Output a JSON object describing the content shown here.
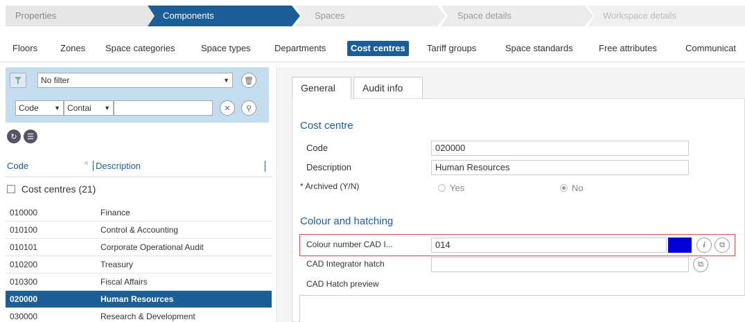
{
  "wizard": {
    "steps": [
      "Properties",
      "Components",
      "Spaces",
      "Space details",
      "Workspace details"
    ]
  },
  "subnav": {
    "items": [
      "Floors",
      "Zones",
      "Space categories",
      "Space types",
      "Departments",
      "Cost centres",
      "Tariff groups",
      "Space standards",
      "Free attributes",
      "Communicat"
    ],
    "active": "Cost centres"
  },
  "filter": {
    "preset_value": "No filter",
    "field_value": "Code",
    "operator_value": "Contai",
    "search_value": ""
  },
  "list": {
    "header_code": "Code",
    "header_sort": "^",
    "header_description": "Description",
    "group_label": "Cost centres (21)",
    "rows": [
      {
        "code": "010000",
        "description": "Finance"
      },
      {
        "code": "010100",
        "description": "Control & Accounting"
      },
      {
        "code": "010101",
        "description": "Corporate Operational Audit"
      },
      {
        "code": "010200",
        "description": "Treasury"
      },
      {
        "code": "010300",
        "description": "Fiscal Affairs"
      },
      {
        "code": "020000",
        "description": "Human Resources"
      },
      {
        "code": "030000",
        "description": "Research & Development"
      }
    ],
    "selected_code": "020000"
  },
  "detail": {
    "tabs": [
      "General",
      "Audit info"
    ],
    "section_cost_centre": "Cost centre",
    "code_label": "Code",
    "code_value": "020000",
    "description_label": "Description",
    "description_value": "Human Resources",
    "archived_label": "* Archived (Y/N)",
    "archived_yes": "Yes",
    "archived_no": "No",
    "section_colour": "Colour and hatching",
    "colour_label": "Colour number CAD I...",
    "colour_value": "014",
    "colour_swatch": "#0000d8",
    "hatch_label": "CAD Integrator hatch",
    "hatch_value": "",
    "hatch_preview_label": "CAD Hatch preview"
  },
  "colors": {
    "active_step": "#1c5f98",
    "inactive_step": "#e6e6e6",
    "filter_bg": "#c3ddef",
    "highlight_border": "#e0474c"
  }
}
